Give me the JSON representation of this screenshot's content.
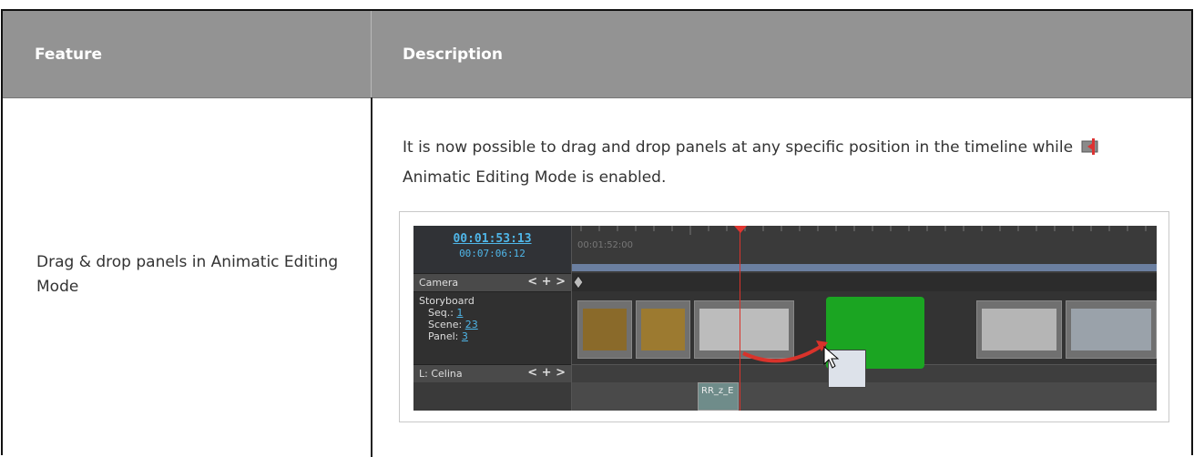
{
  "table": {
    "header": {
      "feature": "Feature",
      "description": "Description"
    },
    "rows": [
      {
        "feature": "Drag & drop panels in Animatic Editing Mode",
        "description_before": "It is now possible to drag and drop panels at any specific position in the timeline while",
        "description_icon": "animatic-editing-mode-icon",
        "description_after": "Animatic Editing Mode is enabled."
      }
    ]
  },
  "screenshot": {
    "timecode_main": "00:01:53:13",
    "timecode_total": "00:07:06:12",
    "ruler_time": "00:01:52:00",
    "camera_label": "Camera",
    "camera_controls": "< + >",
    "storyboard_label": "Storyboard",
    "seq_label": "Seq.:",
    "seq_value": "1",
    "scene_label": "Scene:",
    "scene_value": "23",
    "panel_label": "Panel:",
    "panel_value": "3",
    "layer_label": "L: Celina",
    "layer_controls": "< + >",
    "audio_clip_label": "RR_z_E",
    "colors": {
      "playhead": "#d9332b",
      "insert_marker": "#1ba522",
      "timecode": "#4fb6e8",
      "drag_arrow": "#d9332b"
    }
  }
}
